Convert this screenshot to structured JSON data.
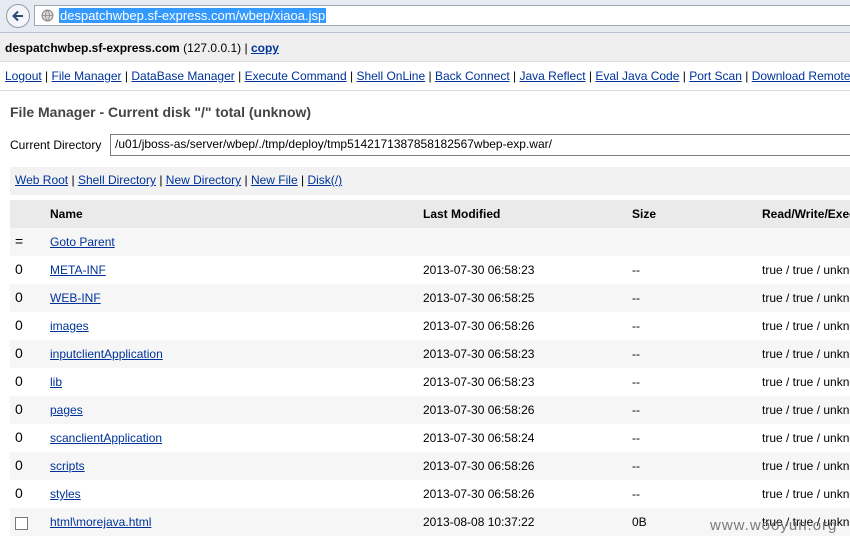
{
  "browser": {
    "url": "despatchwbep.sf-express.com/wbep/xiaoa.jsp"
  },
  "host": {
    "name": "despatchwbep.sf-express.com",
    "ip": "(127.0.0.1)",
    "separator": "|",
    "copy_label": "copy"
  },
  "menu": {
    "items": [
      "Logout",
      "File Manager",
      "DataBase Manager",
      "Execute Command",
      "Shell OnLine",
      "Back Connect",
      "Java Reflect",
      "Eval Java Code",
      "Port Scan",
      "Download Remote"
    ],
    "separator": "|"
  },
  "file_manager": {
    "title": "File Manager - Current disk \"/\" total (unknow)",
    "current_directory_label": "Current Directory",
    "current_directory_value": "/u01/jboss-as/server/wbep/./tmp/deploy/tmp5142171387858182567wbep-exp.war/",
    "links": [
      "Web Root",
      "Shell Directory",
      "New Directory",
      "New File",
      "Disk(/)"
    ],
    "link_separator": "|",
    "columns": [
      "Name",
      "Last Modified",
      "Size",
      "Read/Write/Execute"
    ],
    "parent": {
      "marker": "=",
      "label": "Goto Parent"
    },
    "rows": [
      {
        "count": "0",
        "name": "META-INF",
        "modified": "2013-07-30 06:58:23",
        "size": "--",
        "perm": "true / true / unknow"
      },
      {
        "count": "0",
        "name": "WEB-INF",
        "modified": "2013-07-30 06:58:25",
        "size": "--",
        "perm": "true / true / unknow"
      },
      {
        "count": "0",
        "name": "images",
        "modified": "2013-07-30 06:58:26",
        "size": "--",
        "perm": "true / true / unknow"
      },
      {
        "count": "0",
        "name": "inputclientApplication",
        "modified": "2013-07-30 06:58:23",
        "size": "--",
        "perm": "true / true / unknow"
      },
      {
        "count": "0",
        "name": "lib",
        "modified": "2013-07-30 06:58:23",
        "size": "--",
        "perm": "true / true / unknow"
      },
      {
        "count": "0",
        "name": "pages",
        "modified": "2013-07-30 06:58:26",
        "size": "--",
        "perm": "true / true / unknow"
      },
      {
        "count": "0",
        "name": "scanclientApplication",
        "modified": "2013-07-30 06:58:24",
        "size": "--",
        "perm": "true / true / unknow"
      },
      {
        "count": "0",
        "name": "scripts",
        "modified": "2013-07-30 06:58:26",
        "size": "--",
        "perm": "true / true / unknow"
      },
      {
        "count": "0",
        "name": "styles",
        "modified": "2013-07-30 06:58:26",
        "size": "--",
        "perm": "true / true / unknow"
      }
    ],
    "file_row": {
      "name": "html\\morejava.html",
      "modified": "2013-08-08 10:37:22",
      "size": "0B",
      "perm": "true / true / unknow"
    }
  },
  "watermark": "www.wooyun.org",
  "colors": {
    "link": "#003399",
    "url_highlight": "#3399ff"
  }
}
